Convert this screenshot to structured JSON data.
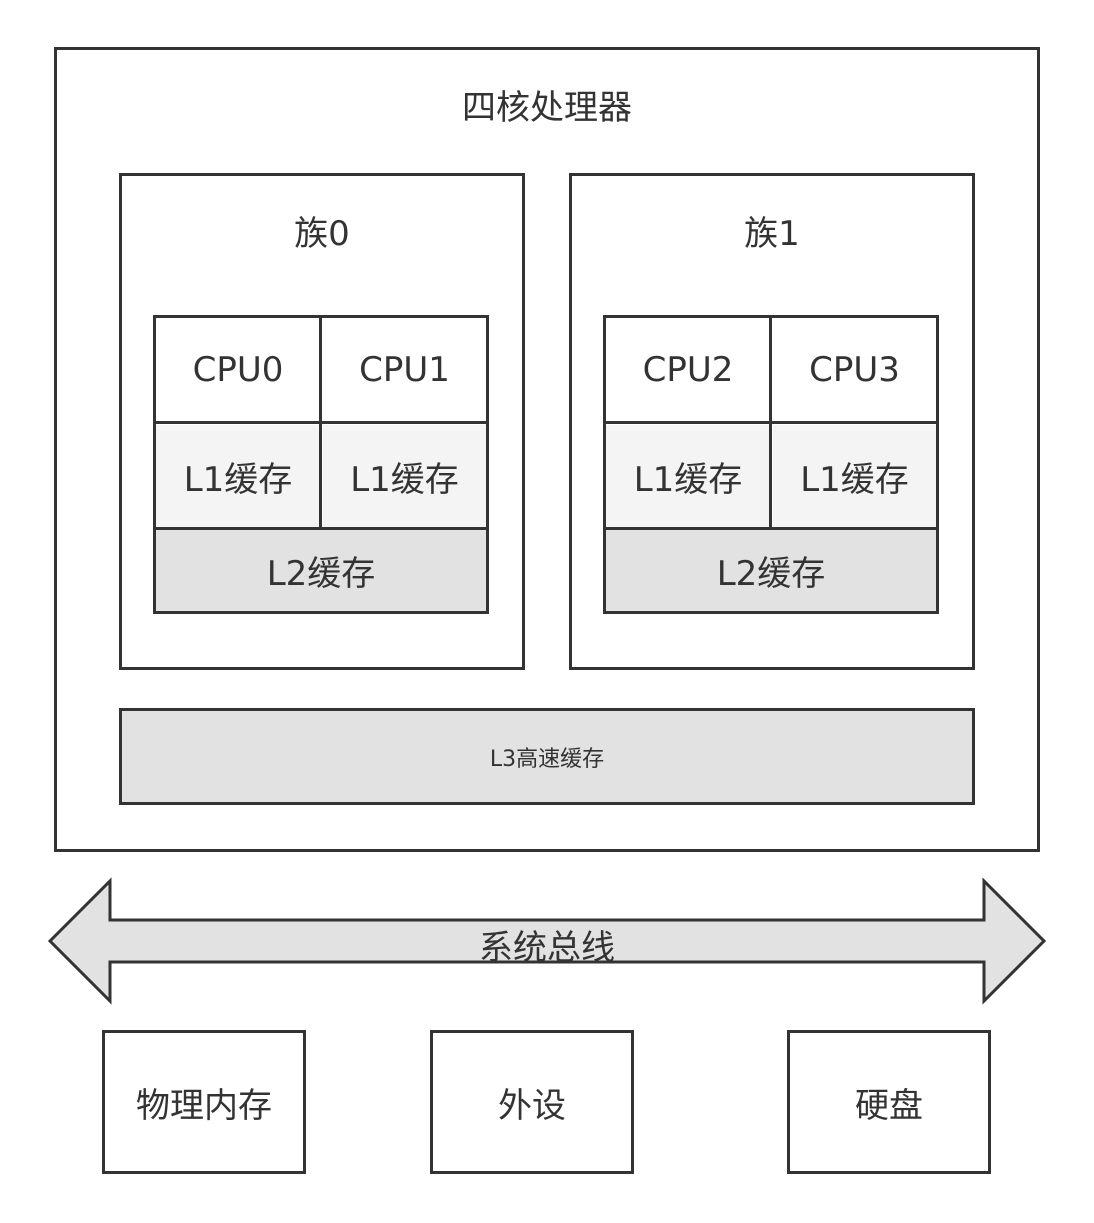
{
  "processor": {
    "title": "四核处理器",
    "clusters": [
      {
        "title": "族0",
        "cpus": [
          "CPU0",
          "CPU1"
        ],
        "l1": [
          "L1缓存",
          "L1缓存"
        ],
        "l2": "L2缓存"
      },
      {
        "title": "族1",
        "cpus": [
          "CPU2",
          "CPU3"
        ],
        "l1": [
          "L1缓存",
          "L1缓存"
        ],
        "l2": "L2缓存"
      }
    ],
    "l3": "L3高速缓存"
  },
  "bus": {
    "label": "系统总线"
  },
  "devices": [
    "物理内存",
    "外设",
    "硬盘"
  ],
  "colors": {
    "stroke": "#333333",
    "l1_fill": "#f4f4f4",
    "l2_fill": "#e2e2e2",
    "l3_fill": "#e2e2e2",
    "bus_fill": "#e2e2e2"
  }
}
